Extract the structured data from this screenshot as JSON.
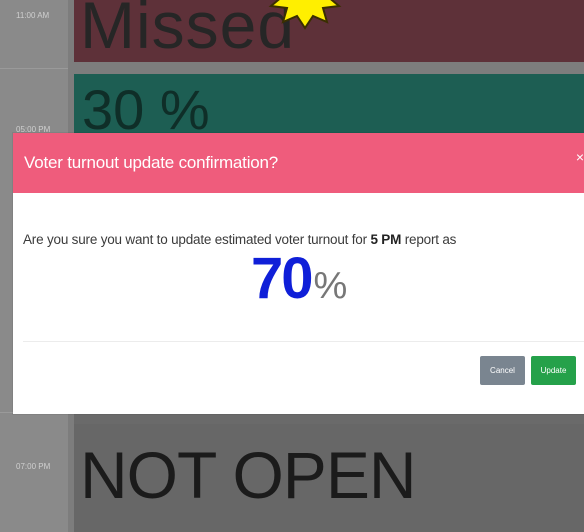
{
  "timeline": {
    "times": [
      "11:00 AM",
      "05:00 PM",
      "07:00 PM"
    ],
    "slots": {
      "missed": "Missed",
      "thirty": "30 %",
      "not_open": "NOT OPEN"
    }
  },
  "colors": {
    "missed_bg": "#5e3139",
    "thirty_bg": "#1d5e53",
    "header": "#ef5c7c",
    "value": "#0f1fd8",
    "update_btn": "#25a14a",
    "cancel_btn": "#7a8590"
  },
  "modal": {
    "title": "Voter turnout update confirmation?",
    "close": "×",
    "question_before": "Are you sure you want to update estimated voter turnout for ",
    "question_time": "5 PM",
    "question_after": " report as",
    "value": "70",
    "unit": "%",
    "cancel_label": "Cancel",
    "update_label": "Update"
  }
}
